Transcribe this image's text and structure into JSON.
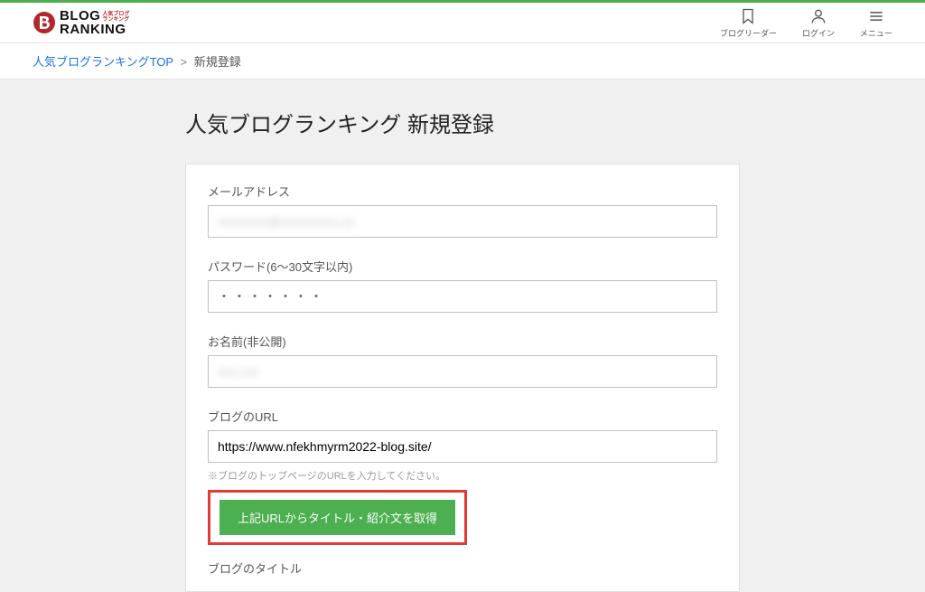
{
  "logo": {
    "main": "BLOG",
    "sub_small": "人気ブログ\nランキング",
    "second_line": "RANKING"
  },
  "nav": {
    "reader": "ブログリーダー",
    "login": "ログイン",
    "menu": "メニュー"
  },
  "breadcrumb": {
    "top": "人気ブログランキングTOP",
    "sep": ">",
    "current": "新規登録"
  },
  "page_title": "人気ブログランキング 新規登録",
  "form": {
    "email_label": "メールアドレス",
    "email_value": "xxxxxxxx@xxxxxxxxx.xx",
    "password_label": "パスワード(6〜30文字以内)",
    "password_value": "・・・・・・・",
    "name_label": "お名前(非公開)",
    "name_value": "xxx xxx",
    "url_label": "ブログのURL",
    "url_value": "https://www.nfekhmyrm2022-blog.site/",
    "url_hint": "※ブログのトップページのURLを入力してください。",
    "fetch_button": "上記URLからタイトル・紹介文を取得",
    "blog_title_label": "ブログのタイトル"
  }
}
